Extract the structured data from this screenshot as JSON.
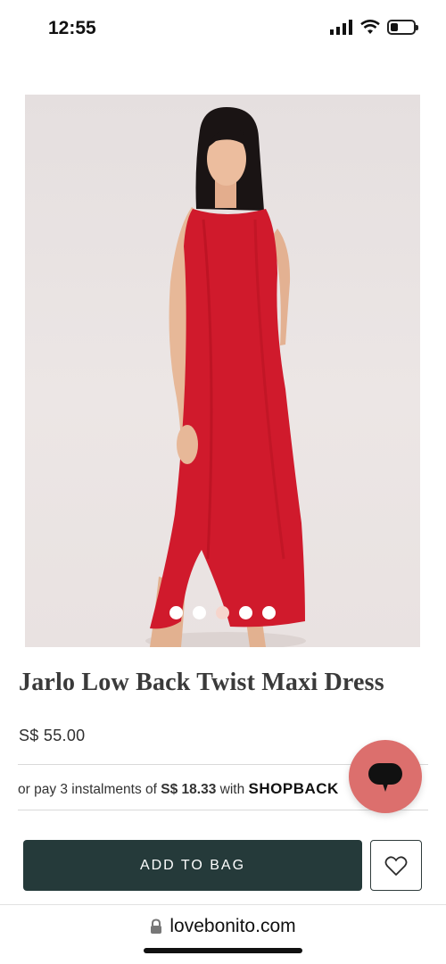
{
  "status_bar": {
    "time": "12:55",
    "icons": [
      "signal-icon",
      "wifi-icon",
      "battery-icon"
    ]
  },
  "gallery": {
    "image_alt": "Model wearing red sleeveless maxi dress",
    "dot_count": 5,
    "active_dot_index": 2,
    "dress_color": "#d01a2c"
  },
  "product": {
    "title": "Jarlo Low Back Twist Maxi Dress",
    "price": "S$ 55.00"
  },
  "instalment": {
    "prefix": "or pay 3 instalments of",
    "amount": "S$ 18.33",
    "with": "with",
    "provider": "SHOPBACK"
  },
  "chat": {
    "icon": "chat-icon",
    "color": "#dc6f6d"
  },
  "actions": {
    "add_to_bag_label": "ADD TO BAG",
    "wishlist_icon": "heart-icon",
    "button_color": "#253a3a"
  },
  "browser": {
    "url": "lovebonito.com",
    "lock_icon": "lock-icon"
  }
}
